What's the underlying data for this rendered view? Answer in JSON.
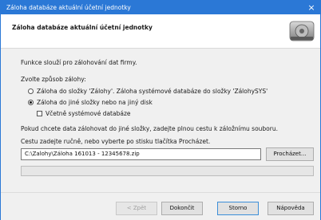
{
  "window": {
    "title": "Záloha databáze aktuální účetní jednotky",
    "close": "×"
  },
  "header": {
    "title": "Záloha databáze aktuální účetní jednotky",
    "icon": "backup-disk-icon"
  },
  "intro": "Funkce slouží pro zálohování dat firmy.",
  "mode": {
    "label": "Zvolte způsob zálohy:",
    "options": [
      {
        "label": "Záloha do složky 'Zálohy'. Záloha systémové databáze do složky 'ZálohySYS'",
        "selected": false
      },
      {
        "label": "Záloha do jiné složky nebo na jiný disk",
        "selected": true
      }
    ],
    "include_system": {
      "label": "Včetně systémové databáze",
      "checked": false
    }
  },
  "path": {
    "hint1": "Pokud chcete data zálohovat do jiné složky, zadejte plnou cestu k záložnímu souboru.",
    "hint2": "Cestu zadejte ručně, nebo vyberte po stisku tlačítka Procházet.",
    "value": "C:\\Zalohy\\Záloha 161013 - 12345678.zip",
    "browse": "Procházet..."
  },
  "progress": {
    "fraction": 0
  },
  "buttons": {
    "back": "< Zpět",
    "finish": "Dokončit",
    "cancel": "Storno",
    "help": "Nápověda"
  },
  "colors": {
    "titlebar": "#2b78d6",
    "accent": "#3c8fd8"
  }
}
